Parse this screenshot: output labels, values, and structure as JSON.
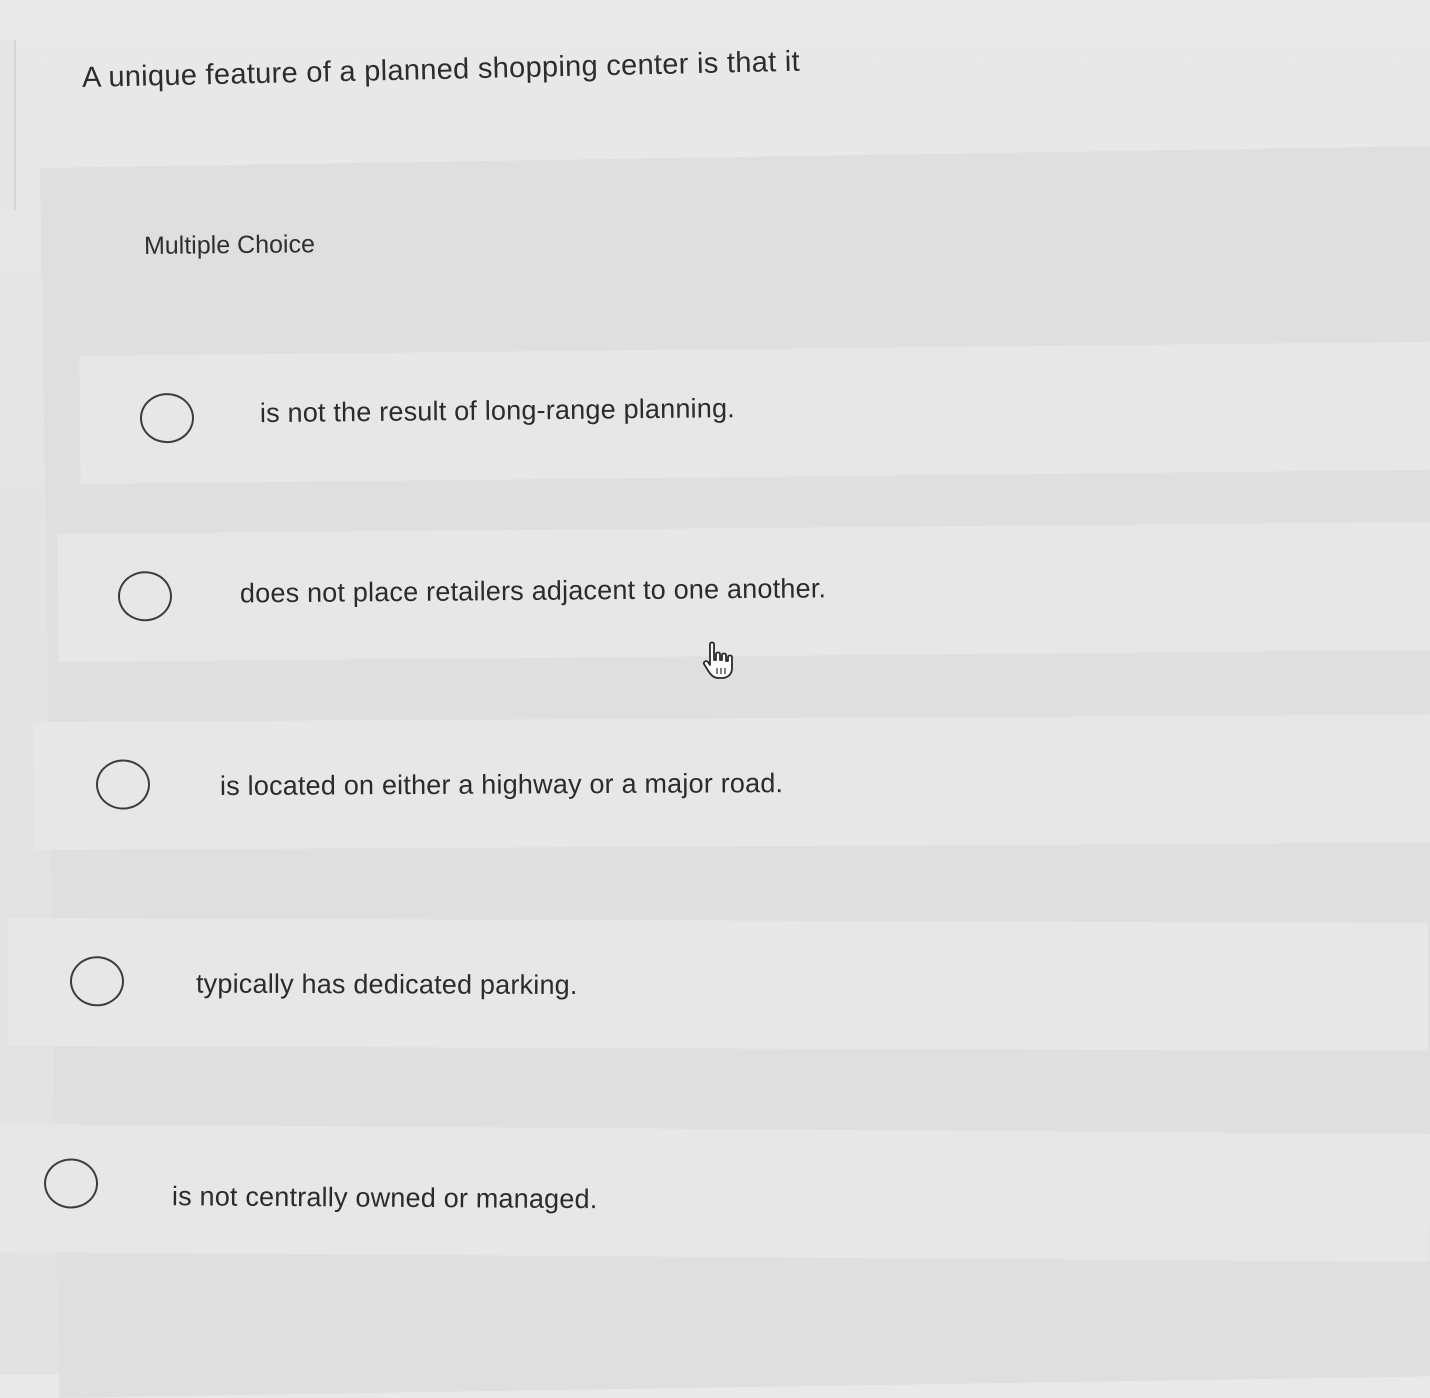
{
  "question": {
    "text": "A unique feature of a planned shopping center is that it"
  },
  "mc": {
    "header": "Multiple Choice",
    "options": [
      {
        "label": "is not the result of long-range planning.",
        "selected": false
      },
      {
        "label": "does not place retailers adjacent to one another.",
        "selected": false
      },
      {
        "label": "is located on either a highway or a major road.",
        "selected": false
      },
      {
        "label": "typically has dedicated parking.",
        "selected": false
      },
      {
        "label": "is not centrally owned or managed.",
        "selected": false
      }
    ]
  },
  "icons": {
    "cursor": "hand-pointer-icon",
    "radio": "radio-circle-icon"
  },
  "colors": {
    "background": "#e6e6e6",
    "panel": "#dfdfdf",
    "option_row": "#e7e7e7",
    "text": "#2c2c2c",
    "radio_border": "#3c3c3c"
  }
}
